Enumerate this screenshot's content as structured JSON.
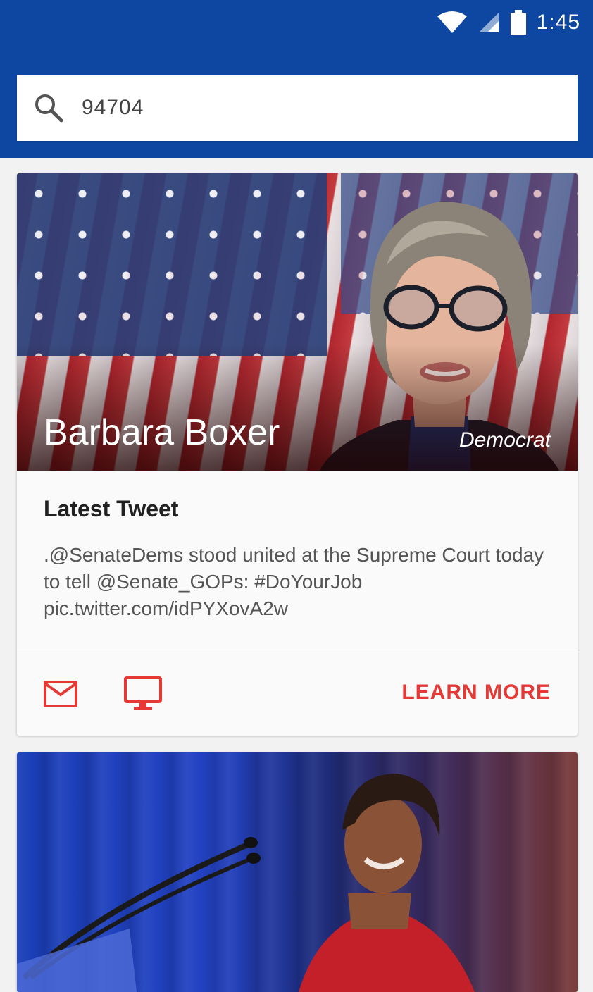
{
  "status_bar": {
    "time": "1:45",
    "icons": [
      "wifi-icon",
      "cell-signal-icon",
      "battery-icon"
    ]
  },
  "search": {
    "value": "94704",
    "icon": "search-icon"
  },
  "colors": {
    "header": "#0d47a1",
    "accent": "#e53935",
    "card_bg": "#fafafa",
    "page_bg": "#f2f2f2"
  },
  "cards": [
    {
      "name": "Barbara Boxer",
      "party": "Democrat",
      "tweet_title": "Latest Tweet",
      "tweet_text": ".@SenateDems stood united at the Supreme Court today to tell @Senate_GOPs: #DoYourJob pic.twitter.com/idPYXovA2w",
      "actions": {
        "email_icon": "mail-icon",
        "website_icon": "monitor-icon",
        "learn_more": "LEARN MORE"
      }
    }
  ]
}
